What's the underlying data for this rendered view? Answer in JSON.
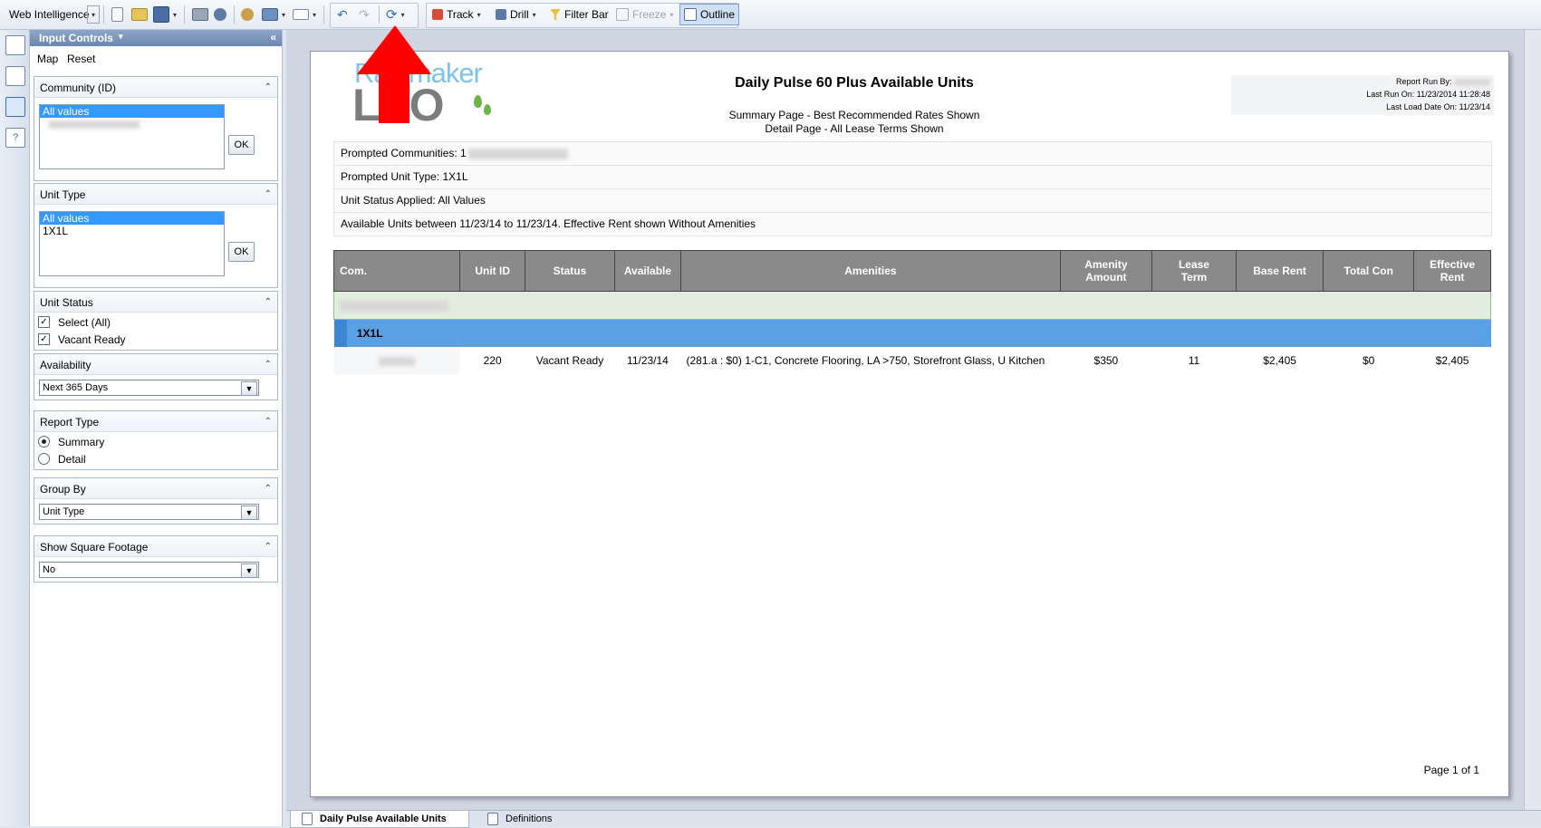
{
  "toolbar": {
    "app_label": "Web Intelligence",
    "track_label": "Track",
    "drill_label": "Drill",
    "filter_bar_label": "Filter Bar",
    "freeze_label": "Freeze",
    "outline_label": "Outline"
  },
  "panel": {
    "title": "Input Controls",
    "collapse_glyph": "«",
    "map_label": "Map",
    "reset_label": "Reset",
    "ok_label": "OK",
    "community": {
      "label": "Community (ID)",
      "options": [
        "All values"
      ]
    },
    "unit_type": {
      "label": "Unit Type",
      "options": [
        "All values",
        "1X1L"
      ]
    },
    "unit_status": {
      "label": "Unit Status",
      "items": [
        "Select (All)",
        "Vacant Ready"
      ]
    },
    "availability": {
      "label": "Availability",
      "value": "Next 365 Days"
    },
    "report_type": {
      "label": "Report Type",
      "options": [
        "Summary",
        "Detail"
      ],
      "selected": "Summary"
    },
    "group_by": {
      "label": "Group By",
      "value": "Unit Type"
    },
    "show_sqft": {
      "label": "Show Square Footage",
      "value": "No"
    }
  },
  "report": {
    "logo_top": "Rainmaker",
    "logo_bottom": "LRO",
    "title": "Daily Pulse 60 Plus Available Units",
    "subtitle1": "Summary Page - Best Recommended Rates Shown",
    "subtitle2": "Detail Page - All Lease Terms Shown",
    "run_by": "Report Run By:",
    "last_run": "Last Run On: 11/23/2014 11:28:48",
    "last_load": "Last Load Date On: 11/23/14",
    "prompt_communities": "Prompted Communities: 1",
    "prompt_unit_type": "Prompted Unit Type: 1X1L",
    "unit_status_applied": "Unit Status Applied: All Values",
    "available_units": "Available Units between 11/23/14 to 11/23/14. Effective Rent shown Without Amenities",
    "columns": [
      "Com.",
      "Unit ID",
      "Status",
      "Available",
      "Amenities",
      "Amenity Amount",
      "Lease Term",
      "Base Rent",
      "Total Con",
      "Effective Rent"
    ],
    "group_label": "1X1L",
    "rows": [
      {
        "unit_id": "220",
        "status": "Vacant Ready",
        "available": "11/23/14",
        "amenities": "(281.a : $0)   1-C1, Concrete Flooring, LA >750, Storefront Glass, U Kitchen",
        "amenity_amount": "$350",
        "lease_term": "11",
        "base_rent": "$2,405",
        "total_con": "$0",
        "effective_rent": "$2,405"
      }
    ],
    "page_label": "Page 1 of 1"
  },
  "tabs": [
    "Daily Pulse Available Units",
    "Definitions"
  ],
  "colors": {
    "group_band": "#5aa0e4",
    "header_gray": "#8a8a8a",
    "community_row": "#e3eddf",
    "arrow": "#ff0000"
  }
}
